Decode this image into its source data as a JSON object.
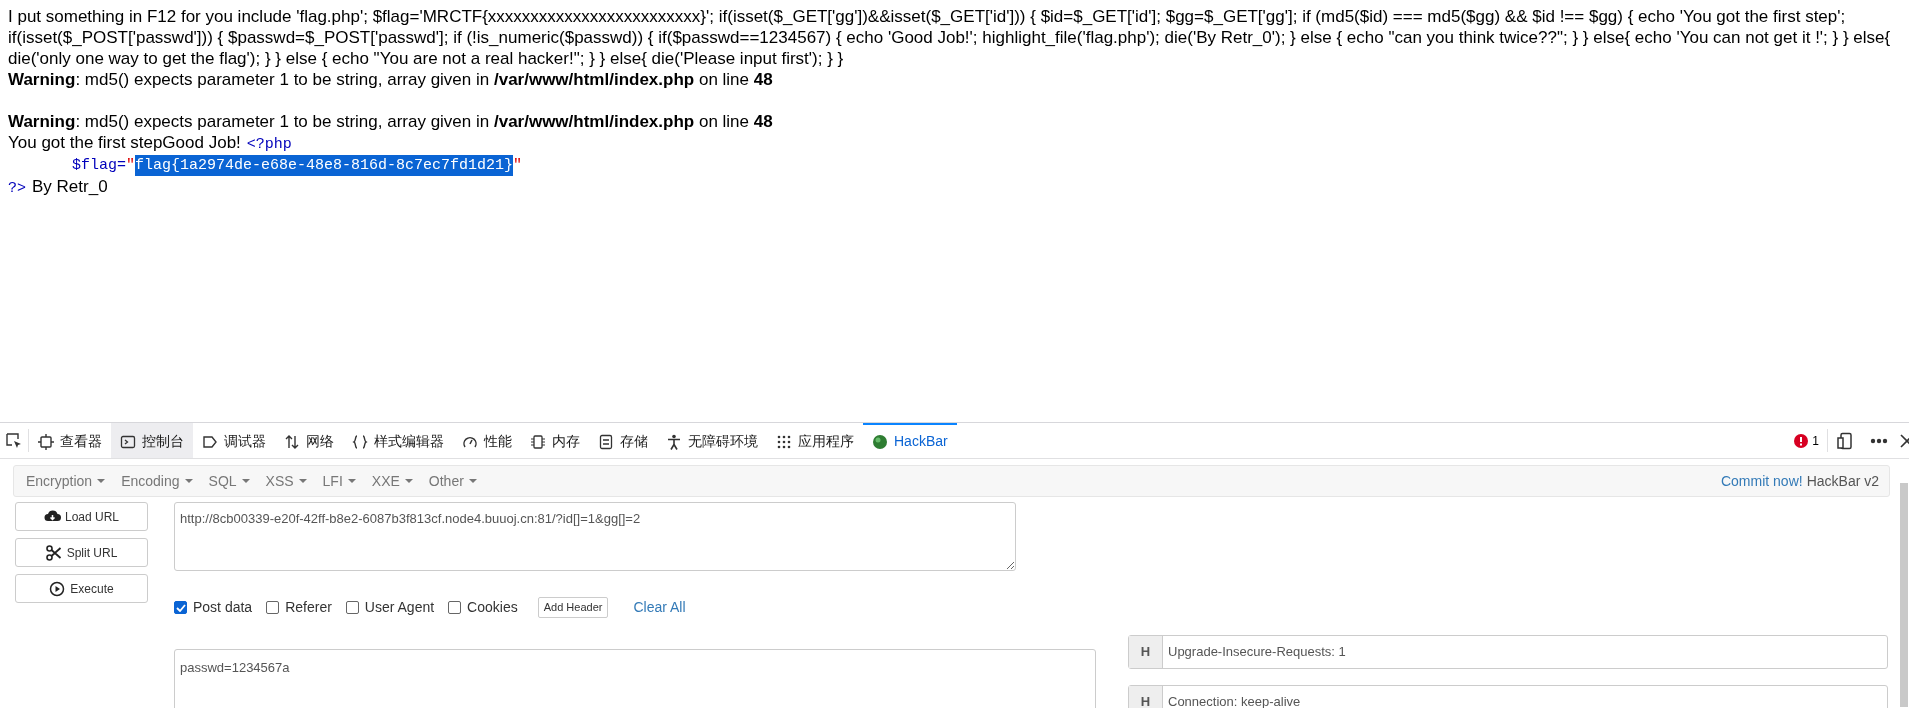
{
  "page": {
    "source_text": "I put something in F12 for you include 'flag.php'; $flag='MRCTF{xxxxxxxxxxxxxxxxxxxxxxxxx}'; if(isset($_GET['gg'])&&isset($_GET['id'])) { $id=$_GET['id']; $gg=$_GET['gg']; if (md5($id) === md5($gg) && $id !== $gg) { echo 'You got the first step'; if(isset($_POST['passwd'])) { $passwd=$_POST['passwd']; if (!is_numeric($passwd)) { if($passwd==1234567) { echo 'Good Job!'; highlight_file('flag.php'); die('By Retr_0'); } else { echo \"can you think twice??\"; } } else{ echo 'You can not get it !'; } } else{ die('only one way to get the flag'); } } else { echo \"You are not a real hacker!\"; } } else{ die('Please input first'); } }",
    "warnings": [
      "**Warning**: md5() expects parameter 1 to be string, array given in **/var/www/html/index.php** on line **48**",
      "**Warning**: md5() expects parameter 1 to be string, array given in **/var/www/html/index.php** on line **48**"
    ],
    "output_text": "You got the first stepGood Job!",
    "highlighted_file": {
      "open_tag": "<?php",
      "variable": "$flag=",
      "quote_open": "\"",
      "flag_value": "flag{1a2974de-e68e-48e8-816d-8c7ec7fd1d21}",
      "flag_selected": true,
      "quote_close": "\"",
      "close_tag": "?>"
    },
    "after_text": "By Retr_0"
  },
  "devtools": {
    "tabs": [
      {
        "kind": "inspector",
        "label": "查看器",
        "selected": false,
        "hovered": false
      },
      {
        "kind": "console",
        "label": "控制台",
        "selected": false,
        "hovered": true
      },
      {
        "kind": "debugger",
        "label": "调试器",
        "selected": false,
        "hovered": false
      },
      {
        "kind": "network",
        "label": "网络",
        "selected": false,
        "hovered": false
      },
      {
        "kind": "style",
        "label": "样式编辑器",
        "selected": false,
        "hovered": false
      },
      {
        "kind": "performance",
        "label": "性能",
        "selected": false,
        "hovered": false
      },
      {
        "kind": "memory",
        "label": "内存",
        "selected": false,
        "hovered": false
      },
      {
        "kind": "storage",
        "label": "存储",
        "selected": false,
        "hovered": false
      },
      {
        "kind": "accessibility",
        "label": "无障碍环境",
        "selected": false,
        "hovered": false
      },
      {
        "kind": "application",
        "label": "应用程序",
        "selected": false,
        "hovered": false
      },
      {
        "kind": "hackbar",
        "label": "HackBar",
        "selected": true,
        "hovered": false
      }
    ],
    "error_count": "1"
  },
  "hackbar": {
    "menus": [
      "Encryption",
      "Encoding",
      "SQL",
      "XSS",
      "LFI",
      "XXE",
      "Other"
    ],
    "commit_link": "Commit now!",
    "version": "HackBar v2",
    "buttons": [
      {
        "kind": "load",
        "label": "Load URL"
      },
      {
        "kind": "split",
        "label": "Split URL"
      },
      {
        "kind": "execute",
        "label": "Execute"
      }
    ],
    "url": "http://8cb00339-e20f-42ff-b8e2-6087b3f813cf.node4.buuoj.cn:81/?id[]=1&gg[]=2",
    "options": [
      {
        "label": "Post data",
        "checked": true
      },
      {
        "label": "Referer",
        "checked": false
      },
      {
        "label": "User Agent",
        "checked": false
      },
      {
        "label": "Cookies",
        "checked": false
      }
    ],
    "add_header": "Add Header",
    "clear_all": "Clear All",
    "post_data": "passwd=1234567a",
    "headers": [
      {
        "key": "H",
        "value": "Upgrade-Insecure-Requests: 1"
      },
      {
        "key": "H",
        "value": "Connection: keep-alive"
      }
    ]
  }
}
